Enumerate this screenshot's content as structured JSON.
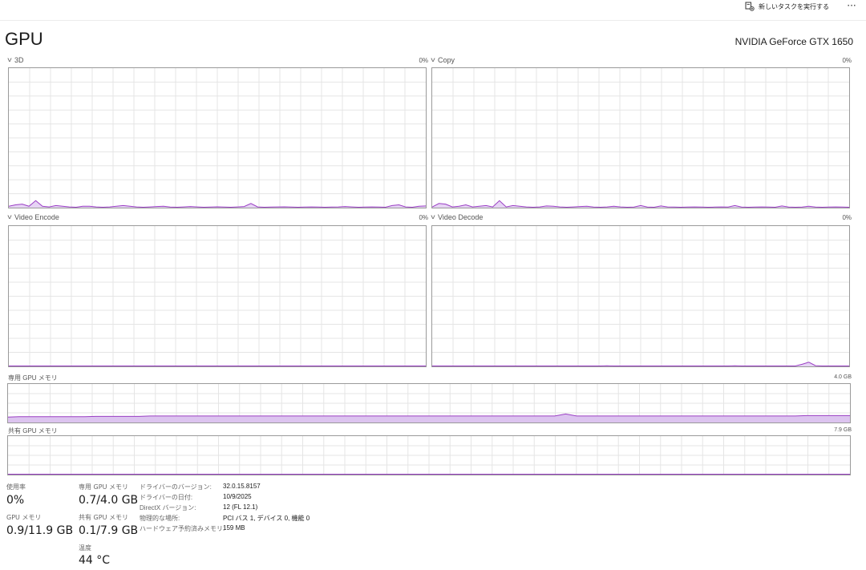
{
  "toolbar": {
    "new_task_label": "新しいタスクを実行する",
    "new_task_icon": "new-task-icon",
    "more_label": "···"
  },
  "header": {
    "title": "GPU",
    "device_name": "NVIDIA GeForce GTX 1650"
  },
  "engines": [
    {
      "name": "3D",
      "percent": "0%",
      "icon": "chevron-down-icon",
      "trend": [
        0.01,
        0.02,
        0.025,
        0.01,
        0.05,
        0.01,
        0.005,
        0.015,
        0.01,
        0.005,
        0.003,
        0.01,
        0.01,
        0.005,
        0.003,
        0.005,
        0.01,
        0.015,
        0.01,
        0.005,
        0.003,
        0.005,
        0.008,
        0.01,
        0.004,
        0.003,
        0.005,
        0.008,
        0.005,
        0.003,
        0.004,
        0.006,
        0.004,
        0.003,
        0.005,
        0.008,
        0.03,
        0.005,
        0.003,
        0.004,
        0.005,
        0.006,
        0.004,
        0.003,
        0.004,
        0.005,
        0.004,
        0.003,
        0.004,
        0.005,
        0.008,
        0.005,
        0.003,
        0.004,
        0.005,
        0.004,
        0.003,
        0.015,
        0.02,
        0.005,
        0.003,
        0.01,
        0.012
      ]
    },
    {
      "name": "Copy",
      "percent": "0%",
      "icon": "chevron-down-icon",
      "trend": [
        0.005,
        0.03,
        0.025,
        0.005,
        0.01,
        0.02,
        0.005,
        0.01,
        0.015,
        0.005,
        0.05,
        0.005,
        0.015,
        0.01,
        0.005,
        0.003,
        0.005,
        0.012,
        0.01,
        0.005,
        0.003,
        0.005,
        0.008,
        0.01,
        0.004,
        0.003,
        0.005,
        0.01,
        0.005,
        0.003,
        0.004,
        0.015,
        0.004,
        0.003,
        0.012,
        0.005,
        0.004,
        0.003,
        0.004,
        0.005,
        0.004,
        0.003,
        0.004,
        0.005,
        0.004,
        0.015,
        0.004,
        0.003,
        0.004,
        0.005,
        0.004,
        0.003,
        0.012,
        0.004,
        0.003,
        0.004,
        0.01,
        0.004,
        0.003,
        0.004,
        0.005,
        0.004,
        0.003
      ]
    },
    {
      "name": "Video Encode",
      "percent": "0%",
      "icon": "chevron-down-icon",
      "trend": [
        0,
        0,
        0,
        0,
        0,
        0,
        0,
        0,
        0,
        0,
        0,
        0,
        0,
        0,
        0,
        0,
        0,
        0,
        0,
        0,
        0,
        0,
        0,
        0,
        0,
        0,
        0,
        0,
        0,
        0,
        0,
        0,
        0,
        0,
        0,
        0,
        0,
        0,
        0,
        0,
        0,
        0,
        0,
        0,
        0,
        0,
        0,
        0,
        0,
        0,
        0,
        0,
        0,
        0,
        0,
        0,
        0,
        0,
        0,
        0,
        0,
        0,
        0
      ]
    },
    {
      "name": "Video Decode",
      "percent": "0%",
      "icon": "chevron-down-icon",
      "trend": [
        0,
        0,
        0,
        0,
        0,
        0,
        0,
        0,
        0,
        0,
        0,
        0,
        0,
        0,
        0,
        0,
        0,
        0,
        0,
        0,
        0,
        0,
        0,
        0,
        0,
        0,
        0.004,
        0,
        0,
        0,
        0,
        0,
        0,
        0,
        0,
        0,
        0,
        0,
        0,
        0,
        0,
        0,
        0,
        0,
        0,
        0.004,
        0,
        0,
        0,
        0,
        0,
        0,
        0,
        0,
        0,
        0.015,
        0.03,
        0.005,
        0,
        0,
        0,
        0,
        0
      ]
    }
  ],
  "dedicated_memory": {
    "label": "専用 GPU メモリ",
    "max": "4.0 GB",
    "trend": [
      0.14,
      0.15,
      0.15,
      0.15,
      0.15,
      0.15,
      0.15,
      0.15,
      0.16,
      0.16,
      0.16,
      0.16,
      0.16,
      0.17,
      0.17,
      0.17,
      0.17,
      0.17,
      0.17,
      0.17,
      0.17,
      0.17,
      0.17,
      0.17,
      0.17,
      0.17,
      0.17,
      0.17,
      0.17,
      0.17,
      0.17,
      0.17,
      0.17,
      0.17,
      0.17,
      0.17,
      0.17,
      0.17,
      0.17,
      0.17,
      0.17,
      0.17,
      0.17,
      0.17,
      0.17,
      0.17,
      0.17,
      0.17,
      0.17,
      0.17,
      0.17,
      0.22,
      0.17,
      0.17,
      0.17,
      0.17,
      0.17,
      0.17,
      0.17,
      0.17,
      0.17,
      0.17,
      0.17,
      0.17,
      0.17,
      0.17,
      0.17,
      0.17,
      0.17,
      0.17,
      0.17,
      0.17,
      0.17,
      0.18,
      0.18,
      0.18,
      0.18,
      0.18
    ]
  },
  "shared_memory": {
    "label": "共有 GPU メモリ",
    "max": "7.9 GB",
    "trend": [
      0,
      0,
      0,
      0,
      0,
      0,
      0,
      0,
      0,
      0,
      0,
      0,
      0,
      0,
      0,
      0,
      0,
      0,
      0,
      0,
      0,
      0,
      0,
      0,
      0,
      0,
      0,
      0,
      0,
      0,
      0,
      0,
      0,
      0,
      0,
      0,
      0,
      0,
      0,
      0,
      0,
      0,
      0,
      0,
      0,
      0,
      0,
      0,
      0,
      0,
      0,
      0,
      0,
      0,
      0,
      0,
      0,
      0,
      0,
      0,
      0,
      0,
      0,
      0,
      0,
      0,
      0,
      0,
      0,
      0,
      0.01,
      0.01,
      0.01,
      0.01,
      0.01,
      0.01,
      0.01,
      0.01
    ]
  },
  "stats": {
    "utilization_label": "使用率",
    "utilization_value": "0%",
    "dedicated_label": "専用 GPU メモリ",
    "dedicated_value": "0.7/4.0 GB",
    "gpu_memory_label": "GPU メモリ",
    "gpu_memory_value": "0.9/11.9 GB",
    "shared_label": "共有 GPU メモリ",
    "shared_value": "0.1/7.9 GB",
    "temperature_label": "温度",
    "temperature_value": "44 °C"
  },
  "info": [
    {
      "label": "ドライバーのバージョン:",
      "value": "32.0.15.8157"
    },
    {
      "label": "ドライバーの日付:",
      "value": "10/9/2025"
    },
    {
      "label": "DirectX バージョン:",
      "value": "12 (FL 12.1)"
    },
    {
      "label": "物理的な場所:",
      "value": "PCI バス 1, デバイス 0, 機能 0"
    },
    {
      "label": "ハードウェア予約済みメモリ:",
      "value": "159 MB"
    }
  ],
  "colors": {
    "line": "#9a3fc4",
    "fill": "#e6d4f4",
    "mem_fill": "#dcc4ef",
    "grid": "#e5e5e5",
    "border": "#9a9a9a"
  }
}
